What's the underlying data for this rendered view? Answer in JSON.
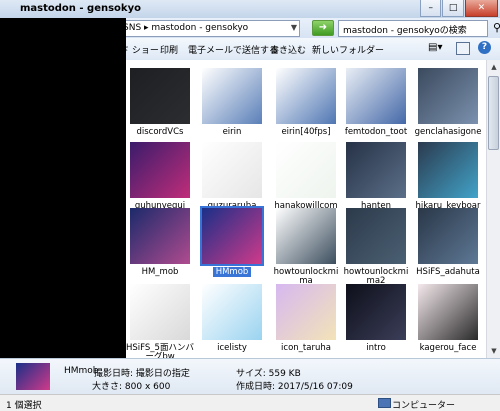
{
  "window": {
    "title": "mastodon - gensokyo"
  },
  "address": {
    "path": "SNS ▸ mastodon - gensokyo",
    "refresh_icon": "refresh-icon"
  },
  "search": {
    "placeholder": "mastodon - gensokyoの検索"
  },
  "toolbar": {
    "items": [
      "ド ショー",
      "印刷",
      "電子メールで送信する",
      "書き込む",
      "新しいフォルダー"
    ]
  },
  "files": [
    {
      "name": "discordVCs",
      "colors": [
        "#1e1f22",
        "#2b2d31"
      ]
    },
    {
      "name": "eirin",
      "colors": [
        "#ffffff",
        "#5a7fb8"
      ]
    },
    {
      "name": "eirin[40fps]",
      "colors": [
        "#ffffff",
        "#4f76b3"
      ]
    },
    {
      "name": "femtodon_toot",
      "colors": [
        "#e9eef5",
        "#4468a8"
      ]
    },
    {
      "name": "genclahasigone",
      "colors": [
        "#3b4a5e",
        "#7b91ae"
      ]
    },
    {
      "name": "guhunyegui",
      "colors": [
        "#3a1c6b",
        "#c02d7a"
      ]
    },
    {
      "name": "guzuraruba",
      "colors": [
        "#ffffff",
        "#e6e6e6"
      ]
    },
    {
      "name": "hanakowillcome",
      "colors": [
        "#ffffff",
        "#eef4ee"
      ]
    },
    {
      "name": "hanten",
      "colors": [
        "#263246",
        "#5b6f88"
      ]
    },
    {
      "name": "hikaru_keyboard",
      "colors": [
        "#2b3a4e",
        "#41a3c9"
      ]
    },
    {
      "name": "HM_mob",
      "colors": [
        "#1b2a6b",
        "#b04b8f"
      ]
    },
    {
      "name": "HMmob",
      "colors": [
        "#1a2f88",
        "#d03a8a"
      ]
    },
    {
      "name": "howtounlockmima",
      "colors": [
        "#ffffff",
        "#3c4e5e"
      ]
    },
    {
      "name": "howtounlockmima2",
      "colors": [
        "#2c3a4b",
        "#4b6073"
      ]
    },
    {
      "name": "HSiFS_adahuta",
      "colors": [
        "#2a3748",
        "#5e7895"
      ]
    },
    {
      "name": "HSiFS_5面ハンバーグbw",
      "colors": [
        "#ffffff",
        "#d9d9d9"
      ]
    },
    {
      "name": "icelisty",
      "colors": [
        "#ffffff",
        "#9ad3f0"
      ]
    },
    {
      "name": "icon_taruha",
      "colors": [
        "#d6b8f0",
        "#f3e3b8"
      ]
    },
    {
      "name": "intro",
      "colors": [
        "#0d0f1a",
        "#3b3e58"
      ]
    },
    {
      "name": "kagerou_face",
      "colors": [
        "#f4e9ec",
        "#2a2a2a"
      ]
    }
  ],
  "selected_file": "HMmob",
  "details": {
    "name": "HMmob",
    "shot_label": "撮影日時:",
    "shot_value": "撮影日の指定",
    "dim_label": "大きさ:",
    "dim_value": "800 x 600",
    "size_label": "サイズ:",
    "size_value": "559 KB",
    "created_label": "作成日時:",
    "created_value": "2017/5/16 07:09"
  },
  "status": {
    "left": "1 個選択",
    "right": "コンピューター"
  }
}
